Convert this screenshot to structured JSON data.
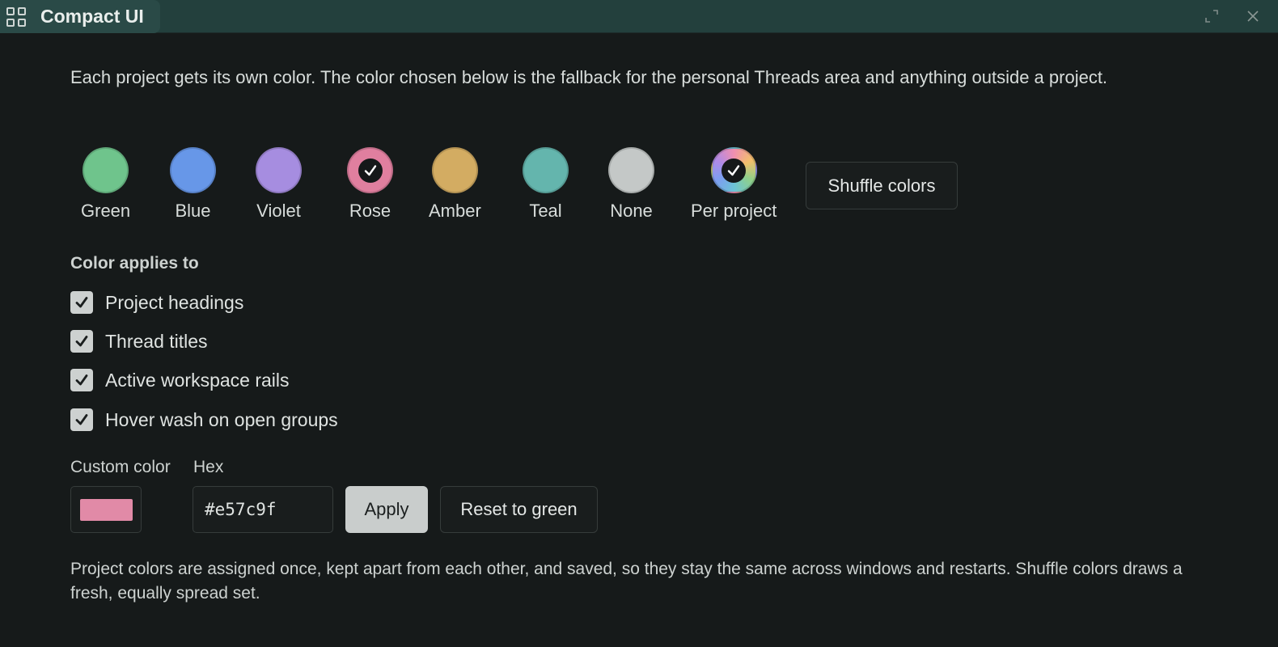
{
  "window": {
    "title": "Compact UI"
  },
  "intro": "Each project gets its own color. The color chosen below is the fallback for the personal Threads area and anything outside a project.",
  "swatches": [
    {
      "label": "Green",
      "color": "#6fc48c",
      "selected": false
    },
    {
      "label": "Blue",
      "color": "#6797e8",
      "selected": false
    },
    {
      "label": "Violet",
      "color": "#a68de0",
      "selected": false
    },
    {
      "label": "Rose",
      "color": "#e07f9f",
      "selected": true
    },
    {
      "label": "Amber",
      "color": "#d3ac62",
      "selected": false
    },
    {
      "label": "Teal",
      "color": "#64b5ad",
      "selected": false
    },
    {
      "label": "None",
      "color": "#c4c8c7",
      "selected": false
    },
    {
      "label": "Per project",
      "color": "conic-rainbow",
      "selected": true
    }
  ],
  "shuffle_label": "Shuffle colors",
  "applies": {
    "heading": "Color applies to",
    "options": [
      {
        "label": "Project headings",
        "checked": true
      },
      {
        "label": "Thread titles",
        "checked": true
      },
      {
        "label": "Active workspace rails",
        "checked": true
      },
      {
        "label": "Hover wash on open groups",
        "checked": true
      }
    ]
  },
  "custom": {
    "color_label": "Custom color",
    "hex_label": "Hex",
    "hex_value": "#e57c9f",
    "preview_color": "#e18aa7",
    "apply_label": "Apply",
    "reset_label": "Reset to green"
  },
  "footer_note": "Project colors are assigned once, kept apart from each other, and saved, so they stay the same across windows and restarts. Shuffle colors draws a fresh, equally spread set."
}
